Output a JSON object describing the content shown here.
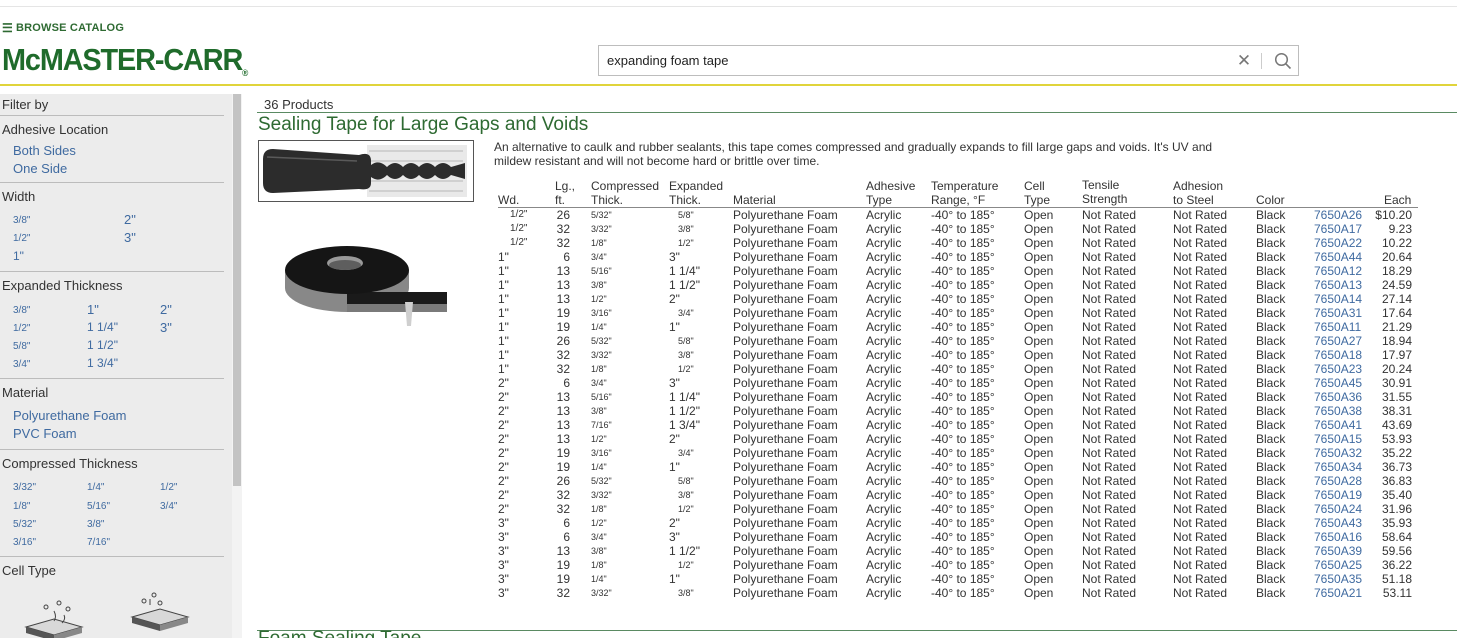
{
  "header": {
    "browse_label": "BROWSE CATALOG",
    "logo_main": "McMASTER-CARR",
    "search_value": "expanding foam tape"
  },
  "sidebar": {
    "filter_by": "Filter by",
    "adhesive_location": {
      "title": "Adhesive Location",
      "items": [
        "Both Sides",
        "One Side"
      ]
    },
    "width": {
      "title": "Width",
      "items": [
        "3/8\"",
        "2\"",
        "1/2\"",
        "3\"",
        "1\""
      ]
    },
    "expanded_thickness": {
      "title": "Expanded Thickness",
      "items": [
        "3/8\"",
        "1\"",
        "2\"",
        "1/2\"",
        "1 1/4\"",
        "3\"",
        "5/8\"",
        "1 1/2\"",
        "3/4\"",
        "1 3/4\""
      ]
    },
    "material": {
      "title": "Material",
      "items": [
        "Polyurethane Foam",
        "PVC Foam"
      ]
    },
    "compressed_thickness": {
      "title": "Compressed Thickness",
      "items": [
        "3/32\"",
        "1/4\"",
        "1/2\"",
        "1/8\"",
        "5/16\"",
        "3/4\"",
        "5/32\"",
        "3/8\"",
        "3/16\"",
        "7/16\""
      ]
    },
    "cell_type": {
      "title": "Cell Type"
    }
  },
  "main": {
    "product_count": "36 Products",
    "section_title": "Sealing Tape for Large Gaps and Voids",
    "description": "An alternative to caulk and rubber sealants, this tape comes compressed and gradually expands to fill large gaps and voids. It's UV and mildew resistant and will not become hard or brittle over time.",
    "next_section_title": "Foam Sealing Tape",
    "headers": {
      "wd": "Wd.",
      "lg1": "Lg.,",
      "lg2": "ft.",
      "comp1": "Compressed",
      "comp2": "Thick.",
      "exp1": "Expanded",
      "exp2": "Thick.",
      "material": "Material",
      "adh1": "Adhesive",
      "adh2": "Type",
      "temp1": "Temperature",
      "temp2": "Range, °F",
      "cell1": "Cell",
      "cell2": "Type",
      "ten1": "Tensile",
      "ten2": "Strength",
      "adst1": "Adhesion",
      "adst2": "to Steel",
      "color": "Color",
      "each": "Each"
    },
    "rows": [
      [
        "1/2\"",
        "26",
        "5/32\"",
        "5/8\"",
        "Polyurethane Foam",
        "Acrylic",
        "-40° to 185°",
        "Open",
        "Not Rated",
        "Not Rated",
        "Black",
        "7650A26",
        "$10.20"
      ],
      [
        "1/2\"",
        "32",
        "3/32\"",
        "3/8\"",
        "Polyurethane Foam",
        "Acrylic",
        "-40° to 185°",
        "Open",
        "Not Rated",
        "Not Rated",
        "Black",
        "7650A17",
        "9.23"
      ],
      [
        "1/2\"",
        "32",
        "1/8\"",
        "1/2\"",
        "Polyurethane Foam",
        "Acrylic",
        "-40° to 185°",
        "Open",
        "Not Rated",
        "Not Rated",
        "Black",
        "7650A22",
        "10.22"
      ],
      [
        "1\"",
        "6",
        "3/4\"",
        "3\"",
        "Polyurethane Foam",
        "Acrylic",
        "-40° to 185°",
        "Open",
        "Not Rated",
        "Not Rated",
        "Black",
        "7650A44",
        "20.64"
      ],
      [
        "1\"",
        "13",
        "5/16\"",
        "1 1/4\"",
        "Polyurethane Foam",
        "Acrylic",
        "-40° to 185°",
        "Open",
        "Not Rated",
        "Not Rated",
        "Black",
        "7650A12",
        "18.29"
      ],
      [
        "1\"",
        "13",
        "3/8\"",
        "1 1/2\"",
        "Polyurethane Foam",
        "Acrylic",
        "-40° to 185°",
        "Open",
        "Not Rated",
        "Not Rated",
        "Black",
        "7650A13",
        "24.59"
      ],
      [
        "1\"",
        "13",
        "1/2\"",
        "2\"",
        "Polyurethane Foam",
        "Acrylic",
        "-40° to 185°",
        "Open",
        "Not Rated",
        "Not Rated",
        "Black",
        "7650A14",
        "27.14"
      ],
      [
        "1\"",
        "19",
        "3/16\"",
        "3/4\"",
        "Polyurethane Foam",
        "Acrylic",
        "-40° to 185°",
        "Open",
        "Not Rated",
        "Not Rated",
        "Black",
        "7650A31",
        "17.64"
      ],
      [
        "1\"",
        "19",
        "1/4\"",
        "1\"",
        "Polyurethane Foam",
        "Acrylic",
        "-40° to 185°",
        "Open",
        "Not Rated",
        "Not Rated",
        "Black",
        "7650A11",
        "21.29"
      ],
      [
        "1\"",
        "26",
        "5/32\"",
        "5/8\"",
        "Polyurethane Foam",
        "Acrylic",
        "-40° to 185°",
        "Open",
        "Not Rated",
        "Not Rated",
        "Black",
        "7650A27",
        "18.94"
      ],
      [
        "1\"",
        "32",
        "3/32\"",
        "3/8\"",
        "Polyurethane Foam",
        "Acrylic",
        "-40° to 185°",
        "Open",
        "Not Rated",
        "Not Rated",
        "Black",
        "7650A18",
        "17.97"
      ],
      [
        "1\"",
        "32",
        "1/8\"",
        "1/2\"",
        "Polyurethane Foam",
        "Acrylic",
        "-40° to 185°",
        "Open",
        "Not Rated",
        "Not Rated",
        "Black",
        "7650A23",
        "20.24"
      ],
      [
        "2\"",
        "6",
        "3/4\"",
        "3\"",
        "Polyurethane Foam",
        "Acrylic",
        "-40° to 185°",
        "Open",
        "Not Rated",
        "Not Rated",
        "Black",
        "7650A45",
        "30.91"
      ],
      [
        "2\"",
        "13",
        "5/16\"",
        "1 1/4\"",
        "Polyurethane Foam",
        "Acrylic",
        "-40° to 185°",
        "Open",
        "Not Rated",
        "Not Rated",
        "Black",
        "7650A36",
        "31.55"
      ],
      [
        "2\"",
        "13",
        "3/8\"",
        "1 1/2\"",
        "Polyurethane Foam",
        "Acrylic",
        "-40° to 185°",
        "Open",
        "Not Rated",
        "Not Rated",
        "Black",
        "7650A38",
        "38.31"
      ],
      [
        "2\"",
        "13",
        "7/16\"",
        "1 3/4\"",
        "Polyurethane Foam",
        "Acrylic",
        "-40° to 185°",
        "Open",
        "Not Rated",
        "Not Rated",
        "Black",
        "7650A41",
        "43.69"
      ],
      [
        "2\"",
        "13",
        "1/2\"",
        "2\"",
        "Polyurethane Foam",
        "Acrylic",
        "-40° to 185°",
        "Open",
        "Not Rated",
        "Not Rated",
        "Black",
        "7650A15",
        "53.93"
      ],
      [
        "2\"",
        "19",
        "3/16\"",
        "3/4\"",
        "Polyurethane Foam",
        "Acrylic",
        "-40° to 185°",
        "Open",
        "Not Rated",
        "Not Rated",
        "Black",
        "7650A32",
        "35.22"
      ],
      [
        "2\"",
        "19",
        "1/4\"",
        "1\"",
        "Polyurethane Foam",
        "Acrylic",
        "-40° to 185°",
        "Open",
        "Not Rated",
        "Not Rated",
        "Black",
        "7650A34",
        "36.73"
      ],
      [
        "2\"",
        "26",
        "5/32\"",
        "5/8\"",
        "Polyurethane Foam",
        "Acrylic",
        "-40° to 185°",
        "Open",
        "Not Rated",
        "Not Rated",
        "Black",
        "7650A28",
        "36.83"
      ],
      [
        "2\"",
        "32",
        "3/32\"",
        "3/8\"",
        "Polyurethane Foam",
        "Acrylic",
        "-40° to 185°",
        "Open",
        "Not Rated",
        "Not Rated",
        "Black",
        "7650A19",
        "35.40"
      ],
      [
        "2\"",
        "32",
        "1/8\"",
        "1/2\"",
        "Polyurethane Foam",
        "Acrylic",
        "-40° to 185°",
        "Open",
        "Not Rated",
        "Not Rated",
        "Black",
        "7650A24",
        "31.96"
      ],
      [
        "3\"",
        "6",
        "1/2\"",
        "2\"",
        "Polyurethane Foam",
        "Acrylic",
        "-40° to 185°",
        "Open",
        "Not Rated",
        "Not Rated",
        "Black",
        "7650A43",
        "35.93"
      ],
      [
        "3\"",
        "6",
        "3/4\"",
        "3\"",
        "Polyurethane Foam",
        "Acrylic",
        "-40° to 185°",
        "Open",
        "Not Rated",
        "Not Rated",
        "Black",
        "7650A16",
        "58.64"
      ],
      [
        "3\"",
        "13",
        "3/8\"",
        "1 1/2\"",
        "Polyurethane Foam",
        "Acrylic",
        "-40° to 185°",
        "Open",
        "Not Rated",
        "Not Rated",
        "Black",
        "7650A39",
        "59.56"
      ],
      [
        "3\"",
        "19",
        "1/8\"",
        "1/2\"",
        "Polyurethane Foam",
        "Acrylic",
        "-40° to 185°",
        "Open",
        "Not Rated",
        "Not Rated",
        "Black",
        "7650A25",
        "36.22"
      ],
      [
        "3\"",
        "19",
        "1/4\"",
        "1\"",
        "Polyurethane Foam",
        "Acrylic",
        "-40° to 185°",
        "Open",
        "Not Rated",
        "Not Rated",
        "Black",
        "7650A35",
        "51.18"
      ],
      [
        "3\"",
        "32",
        "3/32\"",
        "3/8\"",
        "Polyurethane Foam",
        "Acrylic",
        "-40° to 185°",
        "Open",
        "Not Rated",
        "Not Rated",
        "Black",
        "7650A21",
        "53.11"
      ]
    ]
  }
}
